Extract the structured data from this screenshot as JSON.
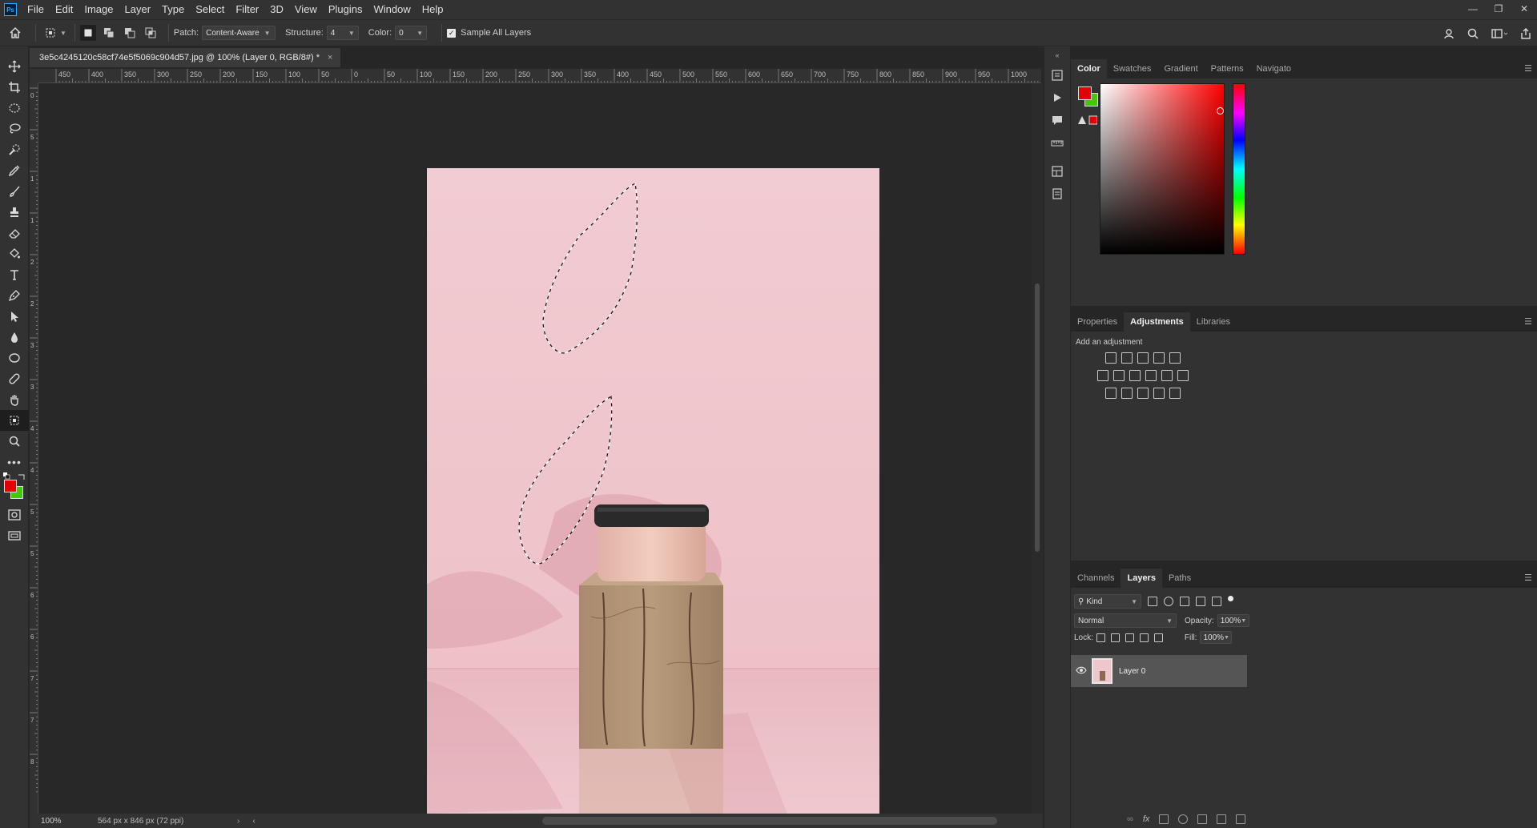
{
  "app": {
    "logo": "Ps"
  },
  "menu": [
    "File",
    "Edit",
    "Image",
    "Layer",
    "Type",
    "Select",
    "Filter",
    "3D",
    "View",
    "Plugins",
    "Window",
    "Help"
  ],
  "window_controls": {
    "minimize": "—",
    "restore": "❐",
    "close": "✕"
  },
  "options": {
    "patch_label": "Patch:",
    "patch_value": "Content-Aware",
    "structure_label": "Structure:",
    "structure_value": "4",
    "color_label": "Color:",
    "color_value": "0",
    "sample_all_layers": "Sample All Layers",
    "sample_all_checked": true
  },
  "document": {
    "tab_title": "3e5c4245120c58cf74e5f5069c904d57.jpg @ 100% (Layer 0, RGB/8#) *",
    "close": "×"
  },
  "ruler": {
    "h_ticks": [
      "450",
      "400",
      "350",
      "300",
      "250",
      "200",
      "150",
      "100",
      "50",
      "0",
      "50",
      "100",
      "150",
      "200",
      "250",
      "300",
      "350",
      "400",
      "450",
      "500",
      "550",
      "600",
      "650",
      "700",
      "750",
      "800",
      "850",
      "900",
      "950",
      "1000"
    ],
    "v_ticks": [
      "0",
      "5",
      "1",
      "1",
      "2",
      "2",
      "3",
      "3",
      "4",
      "4",
      "5",
      "5",
      "6",
      "6",
      "7",
      "7",
      "8"
    ]
  },
  "status": {
    "zoom": "100%",
    "doc_info": "564 px x 846 px (72 ppi)"
  },
  "panels": {
    "color_tabs": [
      "Color",
      "Swatches",
      "Gradient",
      "Patterns",
      "Navigato"
    ],
    "adjust_tabs": [
      "Properties",
      "Adjustments",
      "Libraries"
    ],
    "adjust_title": "Add an adjustment",
    "layers_tabs": [
      "Channels",
      "Layers",
      "Paths"
    ],
    "kind_label": "Kind",
    "blend_mode": "Normal",
    "opacity_label": "Opacity:",
    "opacity_value": "100%",
    "lock_label": "Lock:",
    "fill_label": "Fill:",
    "fill_value": "100%",
    "layer_name": "Layer 0"
  },
  "colors": {
    "foreground": "#e30000",
    "background": "#45c800",
    "accent": "#31a8ff"
  }
}
